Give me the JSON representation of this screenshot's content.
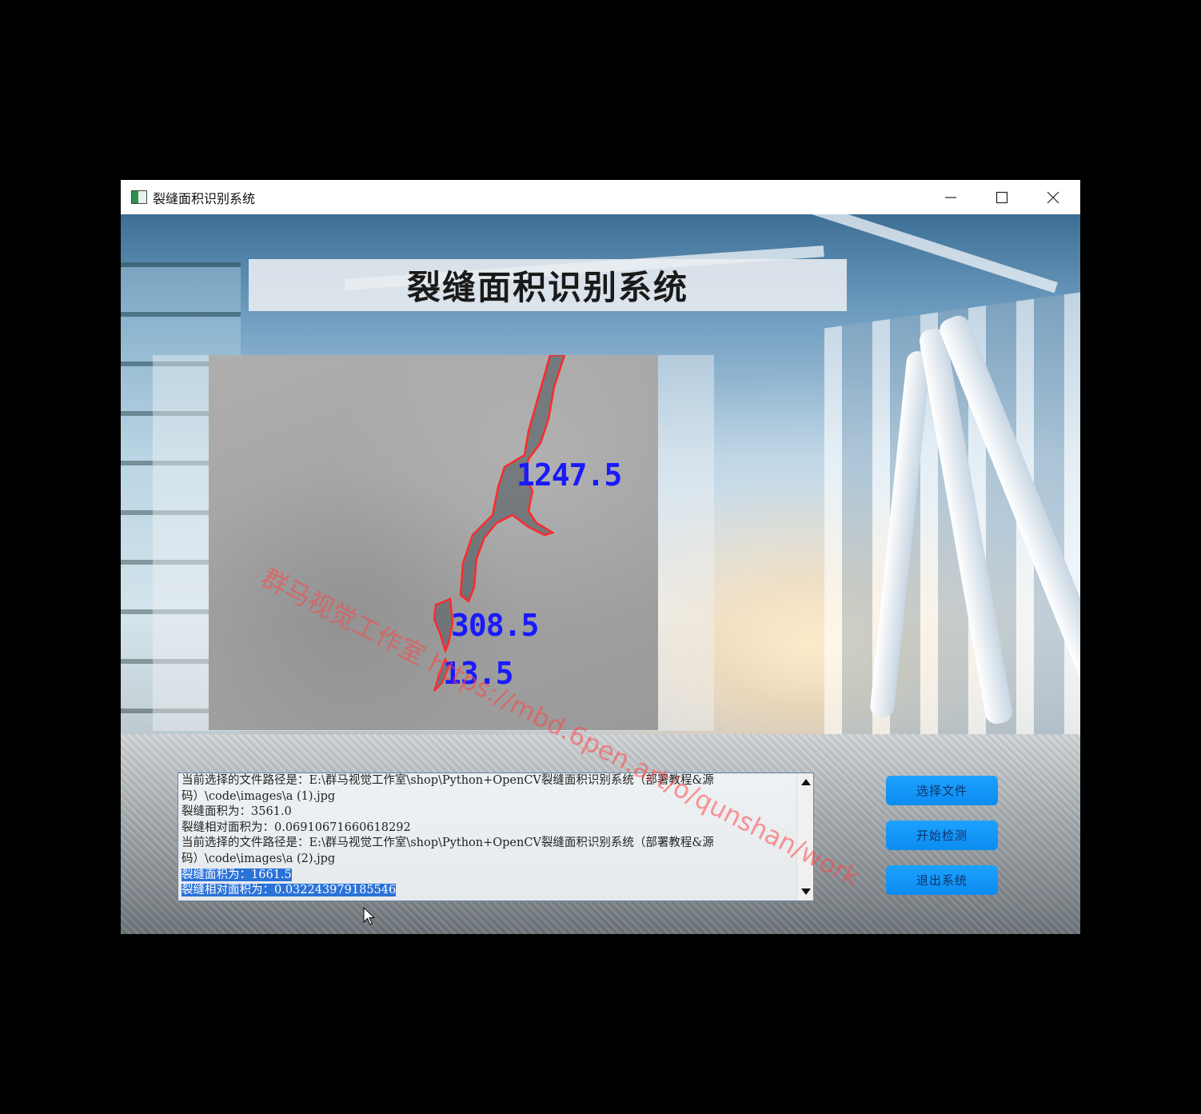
{
  "window": {
    "title": "裂缝面积识别系统",
    "controls": [
      "minimize",
      "maximize",
      "close"
    ]
  },
  "app": {
    "heading": "裂缝面积识别系统"
  },
  "image_view": {
    "labels": [
      "1247.5",
      "308.5",
      "13.5"
    ],
    "contour_color": "#ff2a2a",
    "label_color": "#1a19ff"
  },
  "log": {
    "lines": [
      "当前选择的文件路径是：E:\\群马视觉工作室\\shop\\Python+OpenCV裂缝面积识别系统（部署教程&源",
      "码）\\code\\images\\a (1).jpg",
      "裂缝面积为：3561.0",
      "裂缝相对面积为：0.06910671660618292",
      "当前选择的文件路径是：E:\\群马视觉工作室\\shop\\Python+OpenCV裂缝面积识别系统（部署教程&源",
      "码）\\code\\images\\a (2).jpg",
      "裂缝面积为：1661.5",
      "裂缝相对面积为：0.032243979185546"
    ]
  },
  "buttons": {
    "select_file": "选择文件",
    "start_detect": "开始检测",
    "exit_system": "退出系统"
  },
  "watermark": "群马视觉工作室 https://mbd.6pen.art/o/qunshan/work",
  "colors": {
    "button_bg": "#1a98fb",
    "selection": "#2a72d8"
  }
}
